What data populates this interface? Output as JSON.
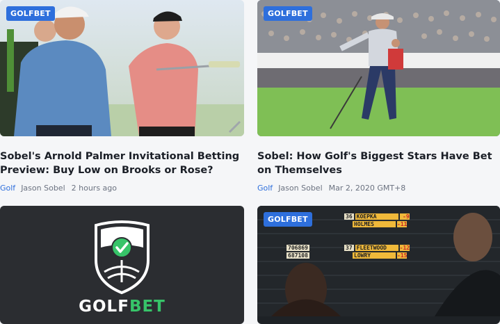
{
  "articles": [
    {
      "badge": "GOLFBET",
      "title": "Sobel's Arnold Palmer Invitational Betting Preview: Buy Low on Brooks or Rose?",
      "category": "Golf",
      "author": "Jason Sobel",
      "time": "2 hours ago"
    },
    {
      "badge": "GOLFBET",
      "title": "Sobel: How Golf's Biggest Stars Have Bet on Themselves",
      "category": "Golf",
      "author": "Jason Sobel",
      "time": "Mar 2, 2020 GMT+8"
    },
    {
      "logo_part1": "GOLF",
      "logo_part2": "BET"
    },
    {
      "badge": "GOLFBET",
      "leaderboard": [
        {
          "pos": "36",
          "name": "KOEPKA",
          "score": "-9"
        },
        {
          "pos": "",
          "name": "HOLMES",
          "score": "-11"
        },
        {
          "pos": "37",
          "name": "FLEETWOOD",
          "score": "-12"
        },
        {
          "pos": "",
          "name": "LOWRY",
          "score": "-15"
        }
      ],
      "board_numbers": [
        "706869",
        "687108"
      ]
    }
  ],
  "colors": {
    "accent": "#2e6fdc",
    "logo_green": "#37c469",
    "page_bg": "#f5f6f8"
  }
}
